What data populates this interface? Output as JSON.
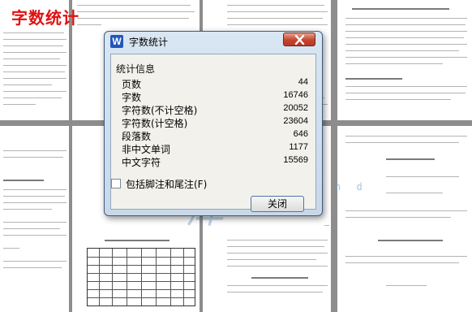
{
  "banner": {
    "title": "字数统计"
  },
  "watermark": {
    "characters": "人文库",
    "url": "w w w . r e n r e n d o c . c o m"
  },
  "dialog": {
    "title": "字数统计",
    "app_icon": "W",
    "close_icon": "close-x",
    "section_label": "统计信息",
    "stats": [
      {
        "label": "页数",
        "value": "44"
      },
      {
        "label": "字数",
        "value": "16746"
      },
      {
        "label": "字符数(不计空格)",
        "value": "20052"
      },
      {
        "label": "字符数(计空格)",
        "value": "23604"
      },
      {
        "label": "段落数",
        "value": "646"
      },
      {
        "label": "非中文单词",
        "value": "1177"
      },
      {
        "label": "中文字符",
        "value": "15569"
      }
    ],
    "include_notes": {
      "label": "包括脚注和尾注(F)",
      "checked": false
    },
    "close_button": "关闭"
  },
  "colors": {
    "banner_red": "#e01010",
    "dialog_border": "#3f5d80",
    "close_red": "#c4452f"
  }
}
